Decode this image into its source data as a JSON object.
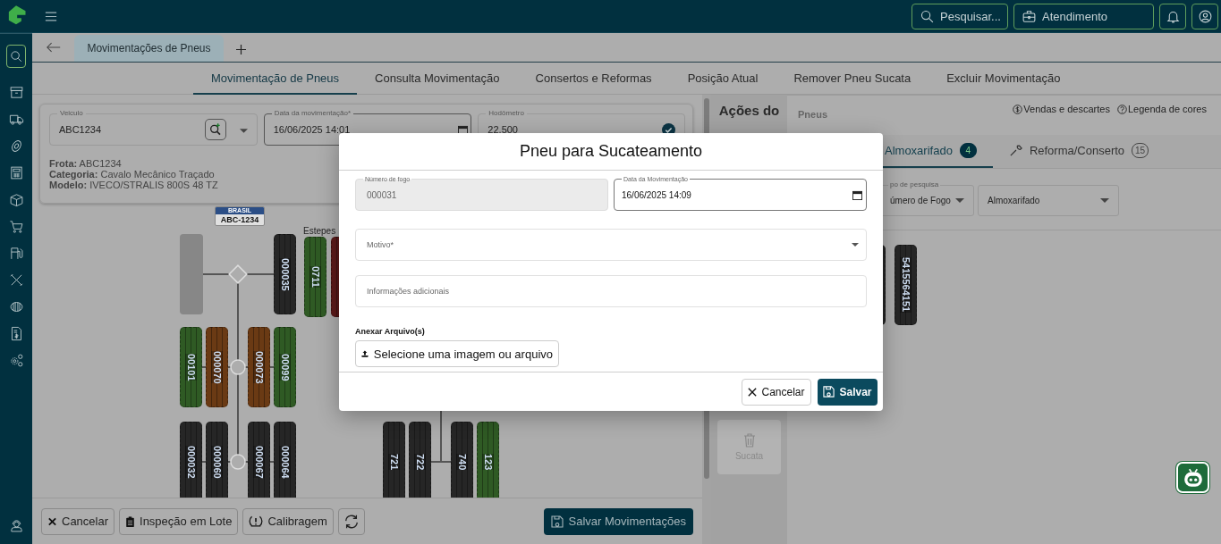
{
  "topbar": {
    "search_button": "Pesquisar...",
    "service_button": "Atendimento"
  },
  "sidebar": {
    "items": [
      {
        "kind": "search",
        "selected": true
      },
      {
        "kind": "archive",
        "selected": false
      },
      {
        "kind": "truck",
        "selected": false
      },
      {
        "kind": "tire",
        "selected": false
      },
      {
        "kind": "calculator",
        "selected": false
      },
      {
        "kind": "box",
        "selected": false
      },
      {
        "kind": "cart",
        "selected": false
      },
      {
        "kind": "fuel",
        "selected": false
      },
      {
        "kind": "tools",
        "selected": false
      },
      {
        "kind": "tires",
        "selected": false
      },
      {
        "kind": "invoice",
        "selected": false
      },
      {
        "kind": "gears",
        "selected": false
      }
    ],
    "footer_item": {
      "kind": "headset"
    }
  },
  "page_tabs": [
    {
      "label": "Movimentações de Pneus",
      "selected": true
    }
  ],
  "nav_tabs": [
    {
      "label": "Movimentação de Pneus",
      "selected": true
    },
    {
      "label": "Consulta Movimentação",
      "selected": false
    },
    {
      "label": "Consertos e Reformas",
      "selected": false
    },
    {
      "label": "Posição Atual",
      "selected": false
    },
    {
      "label": "Remover Pneu Sucata",
      "selected": false
    },
    {
      "label": "Excluir Movimentação",
      "selected": false
    }
  ],
  "vehicle_card": {
    "vehicle": {
      "label": "Veiculo",
      "value": "ABC1234"
    },
    "date": {
      "label": "Data da movimentação*",
      "value": "16/06/2025 14:01"
    },
    "odometer": {
      "label": "Hodômetro",
      "value": "22.500",
      "confirmed": true
    },
    "details": [
      "**Frota:** ABC1234",
      "**Categoria:** Cavalo Mecânico Traçado",
      "**Modelo:** IVECO/STRALIS 800S 48 TZ"
    ]
  },
  "diagram": {
    "plate": {
      "country": "BRASIL",
      "number": "ABC-1234"
    },
    "spares_label": "Estepes",
    "spares": [
      {
        "kind": "tire",
        "number": "0711",
        "color": "#2f5a24"
      },
      {
        "kind": "tire",
        "color": "#5c1a1a"
      }
    ],
    "axles": [
      {
        "kind": "single",
        "left": [
          {
            "kind": "empty"
          }
        ],
        "right": [
          {
            "kind": "tire",
            "number": "000035",
            "color": "#262626"
          }
        ]
      },
      {
        "kind": "dual",
        "left": [
          {
            "kind": "tire",
            "number": "00101",
            "color": "#2f5a24"
          },
          {
            "kind": "tire",
            "number": "000070",
            "color": "#6a3a14"
          }
        ],
        "right": [
          {
            "kind": "tire",
            "number": "000073",
            "color": "#6a3a14"
          },
          {
            "kind": "tire",
            "number": "00099",
            "color": "#2f5a24"
          }
        ]
      },
      {
        "kind": "dual",
        "left": [
          {
            "kind": "tire",
            "number": "000032",
            "color": "#262626"
          },
          {
            "kind": "tire",
            "number": "000060",
            "color": "#262626"
          }
        ],
        "right": [
          {
            "kind": "tire",
            "number": "000067",
            "color": "#262626"
          },
          {
            "kind": "tire",
            "number": "000064",
            "color": "#262626"
          }
        ]
      }
    ],
    "trailer_axles": [
      {
        "kind": "plain",
        "left": [
          {
            "kind": "tire",
            "number": "721",
            "color": "#262626"
          },
          {
            "kind": "tire",
            "number": "722",
            "color": "#262626"
          }
        ],
        "right": [
          {
            "kind": "tire",
            "number": "740",
            "color": "#262626"
          },
          {
            "kind": "tire",
            "number": "123",
            "color": "#2f5a24"
          }
        ]
      }
    ]
  },
  "bottom_bar": {
    "buttons": [
      {
        "kind": "cancel",
        "label": "Cancelar"
      },
      {
        "kind": "batch",
        "label": "Inspeção em Lote"
      },
      {
        "kind": "calibration",
        "label": "Calibragem"
      },
      {
        "kind": "refresh"
      }
    ],
    "save_button": "Salvar Movimentações"
  },
  "actions": {
    "title": "Ações do",
    "buttons": [
      {
        "kind": "scrap",
        "label": "Sucata",
        "disabled": true
      }
    ]
  },
  "right_panel": {
    "title": "Pneus",
    "links": [
      {
        "kind": "sales",
        "label": "Vendas e descartes"
      },
      {
        "kind": "legend",
        "label": "Legenda de cores"
      }
    ],
    "tabs": [
      {
        "kind": "storage",
        "label": "Almoxarifado",
        "count": "4",
        "selected": true
      },
      {
        "kind": "repair",
        "label": "Reforma/Conserto",
        "count": "15",
        "selected": false
      }
    ],
    "filters": [
      {
        "label": "po de pesquisa",
        "value": "úmero de Fogo"
      },
      {
        "value": "Almoxarifado"
      }
    ],
    "tires": [
      {
        "color": "#262626"
      },
      {
        "number": "5415564151",
        "color": "#262626"
      }
    ]
  },
  "modal": {
    "title": "Pneu para Sucateamento",
    "fire_number": {
      "label": "Número de fogo",
      "value": "000031",
      "disabled": true
    },
    "date": {
      "label": "Data da Movimentação",
      "value": "16/06/2025 14:09"
    },
    "reason": {
      "label": "Motivo*"
    },
    "notes": {
      "placeholder": "Informações adicionais"
    },
    "attach_label": "Anexar Arquivo(s)",
    "upload_button": "Selecione uma imagem ou arquivo",
    "cancel_button": "Cancelar",
    "save_button": "Salvar"
  }
}
